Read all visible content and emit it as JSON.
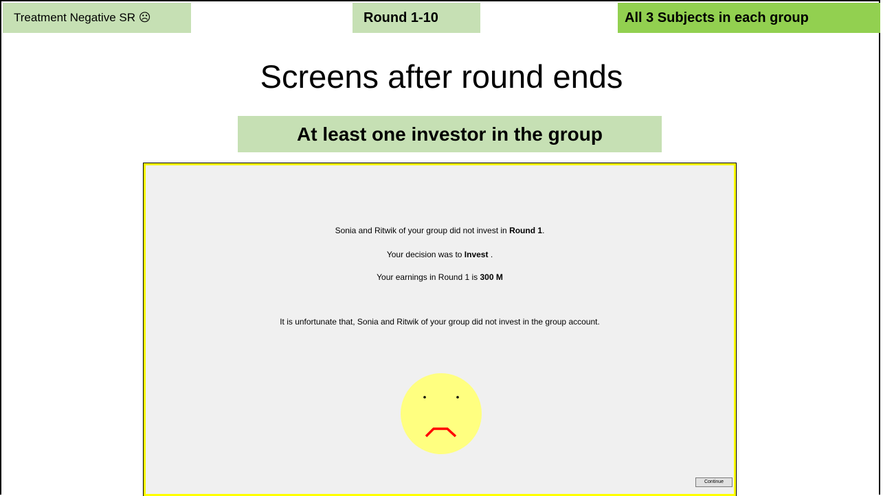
{
  "header": {
    "treatment": "Treatment Negative SR ☹",
    "round": "Round 1-10",
    "subjects": "All 3 Subjects in each group"
  },
  "slide_title": "Screens after round ends",
  "section_banner": "At least one investor in the group",
  "screen": {
    "line1_prefix": "Sonia and Ritwik of your group did not invest in ",
    "line1_bold": "Round 1",
    "line1_suffix": ".",
    "line2_prefix": "Your decision was to ",
    "line2_bold": "Invest",
    "line2_suffix": " .",
    "line3_prefix": "Your earnings in Round 1 is ",
    "line3_bold": "300 M",
    "line4": "It is unfortunate that, Sonia and Ritwik of your group did not invest in the group account.",
    "face_icon": "sad-face-icon",
    "continue_label": "Continue"
  },
  "colors": {
    "tag_light_green": "#c6e0b4",
    "tag_green": "#92d050",
    "screen_border": "#ffff00",
    "face_fill": "#ffff80",
    "frown": "#ff0000"
  }
}
